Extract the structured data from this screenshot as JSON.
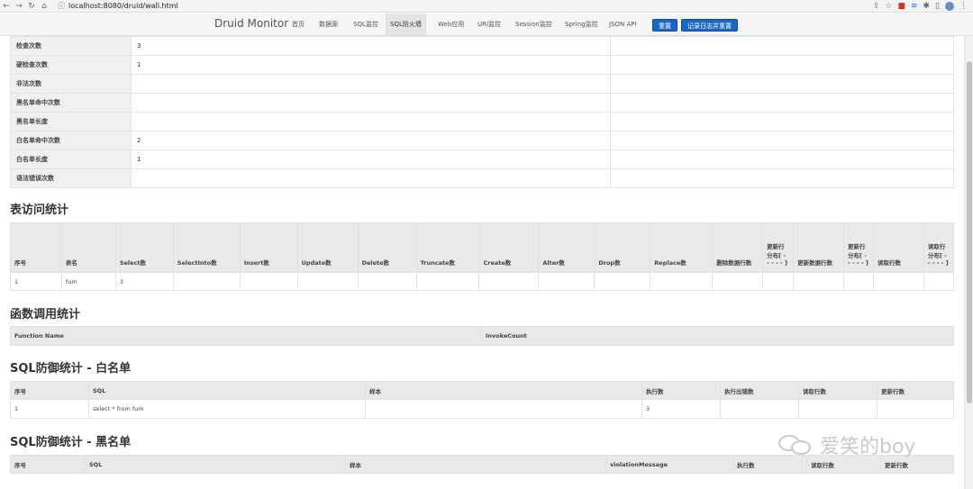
{
  "browser": {
    "url": "localhost:8080/druid/wall.html"
  },
  "navbar": {
    "brand": "Druid Monitor",
    "items": [
      "首页",
      "数据源",
      "SQL监控",
      "SQL防火墙",
      "Web应用",
      "URI监控",
      "Session监控",
      "Spring监控",
      "JSON API"
    ],
    "active_index": 3,
    "reset_label": "重置",
    "log_reset_label": "记录日志并重置"
  },
  "stats": [
    {
      "label": "检查次数",
      "value": "3"
    },
    {
      "label": "硬检查次数",
      "value": "1"
    },
    {
      "label": "非法次数",
      "value": ""
    },
    {
      "label": "黑名单命中次数",
      "value": ""
    },
    {
      "label": "黑名单长度",
      "value": ""
    },
    {
      "label": "白名单命中次数",
      "value": "2"
    },
    {
      "label": "白名单长度",
      "value": "1"
    },
    {
      "label": "语法错误次数",
      "value": ""
    }
  ],
  "table_access": {
    "title": "表访问统计",
    "headers": [
      "序号",
      "表名",
      "Select数",
      "SelectInto数",
      "Insert数",
      "Update数",
      "Delete数",
      "Truncate数",
      "Create数",
      "Alter数",
      "Drop数",
      "Replace数",
      "删除数据行数",
      "更新行分布[ - - - - - ]",
      "更新数据行数",
      "更新行分布[ - - - - - ]",
      "读取行数",
      "读取行分布[ - - - - - ]"
    ],
    "rows": [
      [
        "1",
        "fum",
        "3",
        "",
        "",
        "",
        "",
        "",
        "",
        "",
        "",
        "",
        "",
        "",
        "",
        "",
        "",
        ""
      ]
    ]
  },
  "table_function": {
    "title": "函数调用统计",
    "headers": [
      "Function Name",
      "InvokeCount"
    ]
  },
  "table_whitelist": {
    "title": "SQL防御统计 - 白名单",
    "headers": [
      "序号",
      "SQL",
      "样本",
      "执行数",
      "执行出错数",
      "读取行数",
      "更新行数"
    ],
    "rows": [
      [
        "1",
        "select * from fum",
        "",
        "3",
        "",
        "",
        ""
      ]
    ]
  },
  "table_blacklist": {
    "title": "SQL防御统计 - 黑名单",
    "headers": [
      "序号",
      "SQL",
      "样本",
      "violationMessage",
      "执行数",
      "读取行数",
      "更新行数"
    ]
  },
  "watermark": "爱笑的boy"
}
